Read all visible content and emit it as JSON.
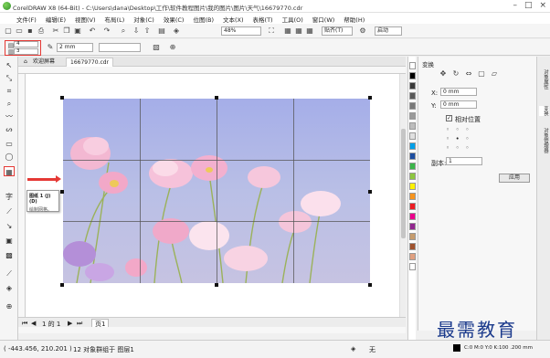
{
  "window": {
    "title": "CorelDRAW X8 (64-Bit) - C:\\Users\\dana\\Desktop\\工作\\软件教程图片\\我的图片\\图片\\天气\\16679770.cdr",
    "controls": [
      "–",
      "□",
      "×"
    ]
  },
  "menu": [
    "文件(F)",
    "编辑(E)",
    "视图(V)",
    "布局(L)",
    "对象(C)",
    "效果(C)",
    "位图(B)",
    "文本(X)",
    "表格(T)",
    "工具(O)",
    "窗口(W)",
    "帮助(H)"
  ],
  "toolbar": {
    "zoom": "48%",
    "snap": "贴齐(T)",
    "launch": "启动"
  },
  "propertybar": {
    "rows": "4",
    "cols": "3",
    "outline_width": "2 mm"
  },
  "tabs": [
    "欢迎屏幕",
    "16679770.cdr"
  ],
  "tooltip": {
    "title": "图纸 1 (J) (D)",
    "body": "绘制网格。"
  },
  "docker": {
    "title": "变换",
    "x_label": "X:",
    "x_value": "0 mm",
    "y_label": "Y:",
    "y_value": "0 mm",
    "relative_label": "相对位置",
    "copies_label": "副本:",
    "copies_value": "1",
    "apply_label": "应用"
  },
  "side_tabs": [
    "对象属性",
    "变换",
    "对象管理器"
  ],
  "pages": {
    "count": "1 的 1",
    "page_tab": "页1"
  },
  "status": {
    "coords": "( -443.456, 210.201 )",
    "selection": "12 对象群组于 图层1",
    "fill_label": "无",
    "outline_info": "C:0 M:0 Y:0 K:100 .200 mm"
  },
  "watermark": "最需教育",
  "colors": {
    "highlight": "#e53935",
    "watermark": "#1b3a8c",
    "palette": [
      "#ffffff",
      "#000000",
      "#3a3a3a",
      "#5a5a5a",
      "#7a7a7a",
      "#9a9a9a",
      "#bdbdbd",
      "#e0e0e0",
      "#00a0e9",
      "#1d4ea1",
      "#3bb54a",
      "#8dc63f",
      "#fff200",
      "#f7941d",
      "#ed1c24",
      "#ec008c",
      "#92278f",
      "#c69c6d",
      "#a0522d",
      "#e0a080",
      "#ffffff"
    ]
  }
}
